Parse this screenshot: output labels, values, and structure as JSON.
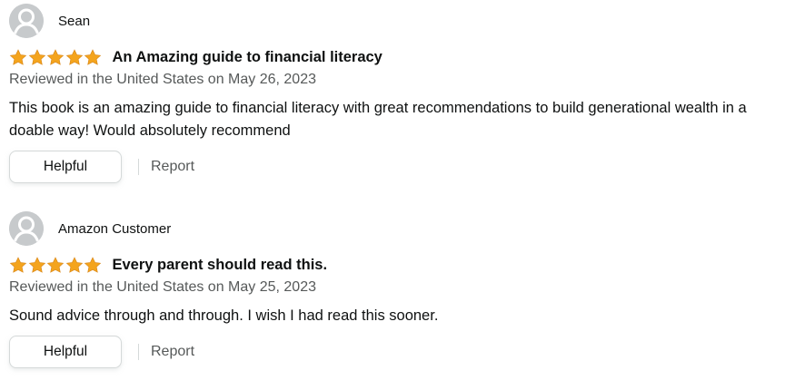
{
  "colors": {
    "star": "#f4a41d",
    "avatar_bg": "#c7cacc",
    "muted_text": "#565959"
  },
  "reviews": [
    {
      "reviewer": "Sean",
      "rating": 5,
      "title": "An Amazing guide to financial literacy",
      "date": "Reviewed in the United States on May 26, 2023",
      "body": "This book is an amazing guide to financial literacy with great recommendations to build generational wealth in a doable way! Would absolutely recommend",
      "helpful_label": "Helpful",
      "report_label": "Report"
    },
    {
      "reviewer": "Amazon Customer",
      "rating": 5,
      "title": "Every parent should read this.",
      "date": "Reviewed in the United States on May 25, 2023",
      "body": "Sound advice through and through. I wish I had read this sooner.",
      "helpful_label": "Helpful",
      "report_label": "Report"
    }
  ]
}
